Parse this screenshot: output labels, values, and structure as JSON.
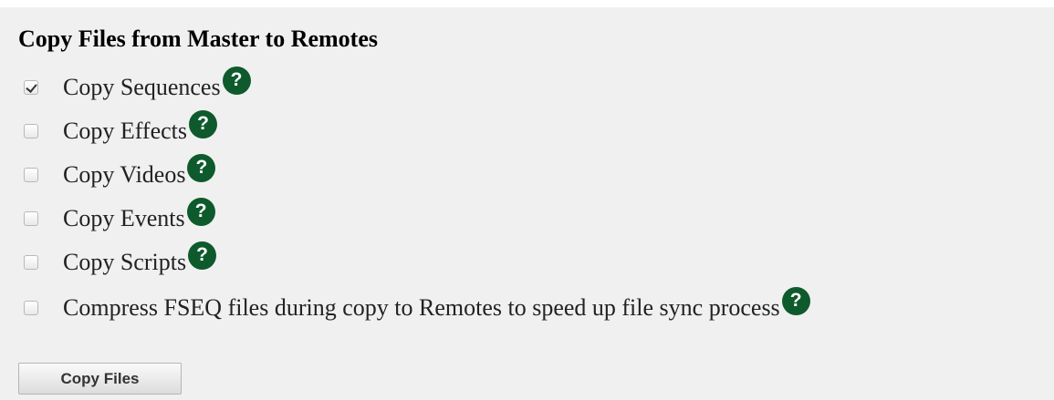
{
  "section": {
    "title": "Copy Files from Master to Remotes"
  },
  "options": [
    {
      "label": "Copy Sequences",
      "checked": true
    },
    {
      "label": "Copy Effects",
      "checked": false
    },
    {
      "label": "Copy Videos",
      "checked": false
    },
    {
      "label": "Copy Events",
      "checked": false
    },
    {
      "label": "Copy Scripts",
      "checked": false
    },
    {
      "label": "Compress FSEQ files during copy to Remotes to speed up file sync process",
      "checked": false
    }
  ],
  "help_icon": {
    "glyph": "?",
    "icon": "help-icon",
    "color": "#0e5a2c"
  },
  "buttons": {
    "copy_files": "Copy Files"
  }
}
